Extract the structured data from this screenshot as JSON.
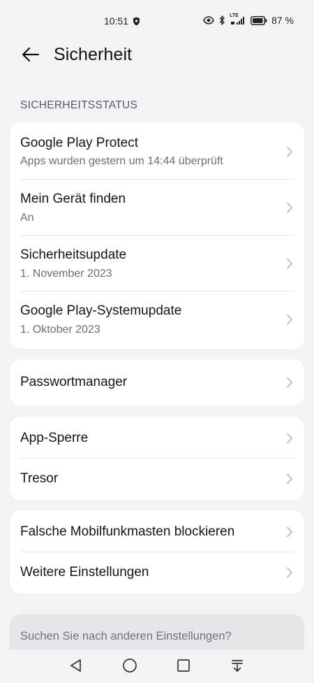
{
  "status_bar": {
    "time": "10:51",
    "battery_percent": "87 %",
    "network_label": "LTE"
  },
  "header": {
    "title": "Sicherheit"
  },
  "section": {
    "label": "SICHERHEITSSTATUS"
  },
  "status_items": [
    {
      "title": "Google Play Protect",
      "subtitle": "Apps wurden gestern um 14:44 überprüft"
    },
    {
      "title": "Mein Gerät finden",
      "subtitle": "An"
    },
    {
      "title": "Sicherheitsupdate",
      "subtitle": "1. November 2023"
    },
    {
      "title": "Google Play-Systemupdate",
      "subtitle": "1. Oktober 2023"
    }
  ],
  "password_manager": {
    "title": "Passwortmanager"
  },
  "lock_items": [
    {
      "title": "App-Sperre"
    },
    {
      "title": "Tresor"
    }
  ],
  "misc_items": [
    {
      "title": "Falsche Mobilfunkmasten blockieren"
    },
    {
      "title": "Weitere Einstellungen"
    }
  ],
  "search": {
    "placeholder": "Suchen Sie nach anderen Einstellungen?"
  },
  "colors": {
    "background": "#f1f3f6",
    "card": "#ffffff",
    "secondary_text": "#6b6f74"
  }
}
